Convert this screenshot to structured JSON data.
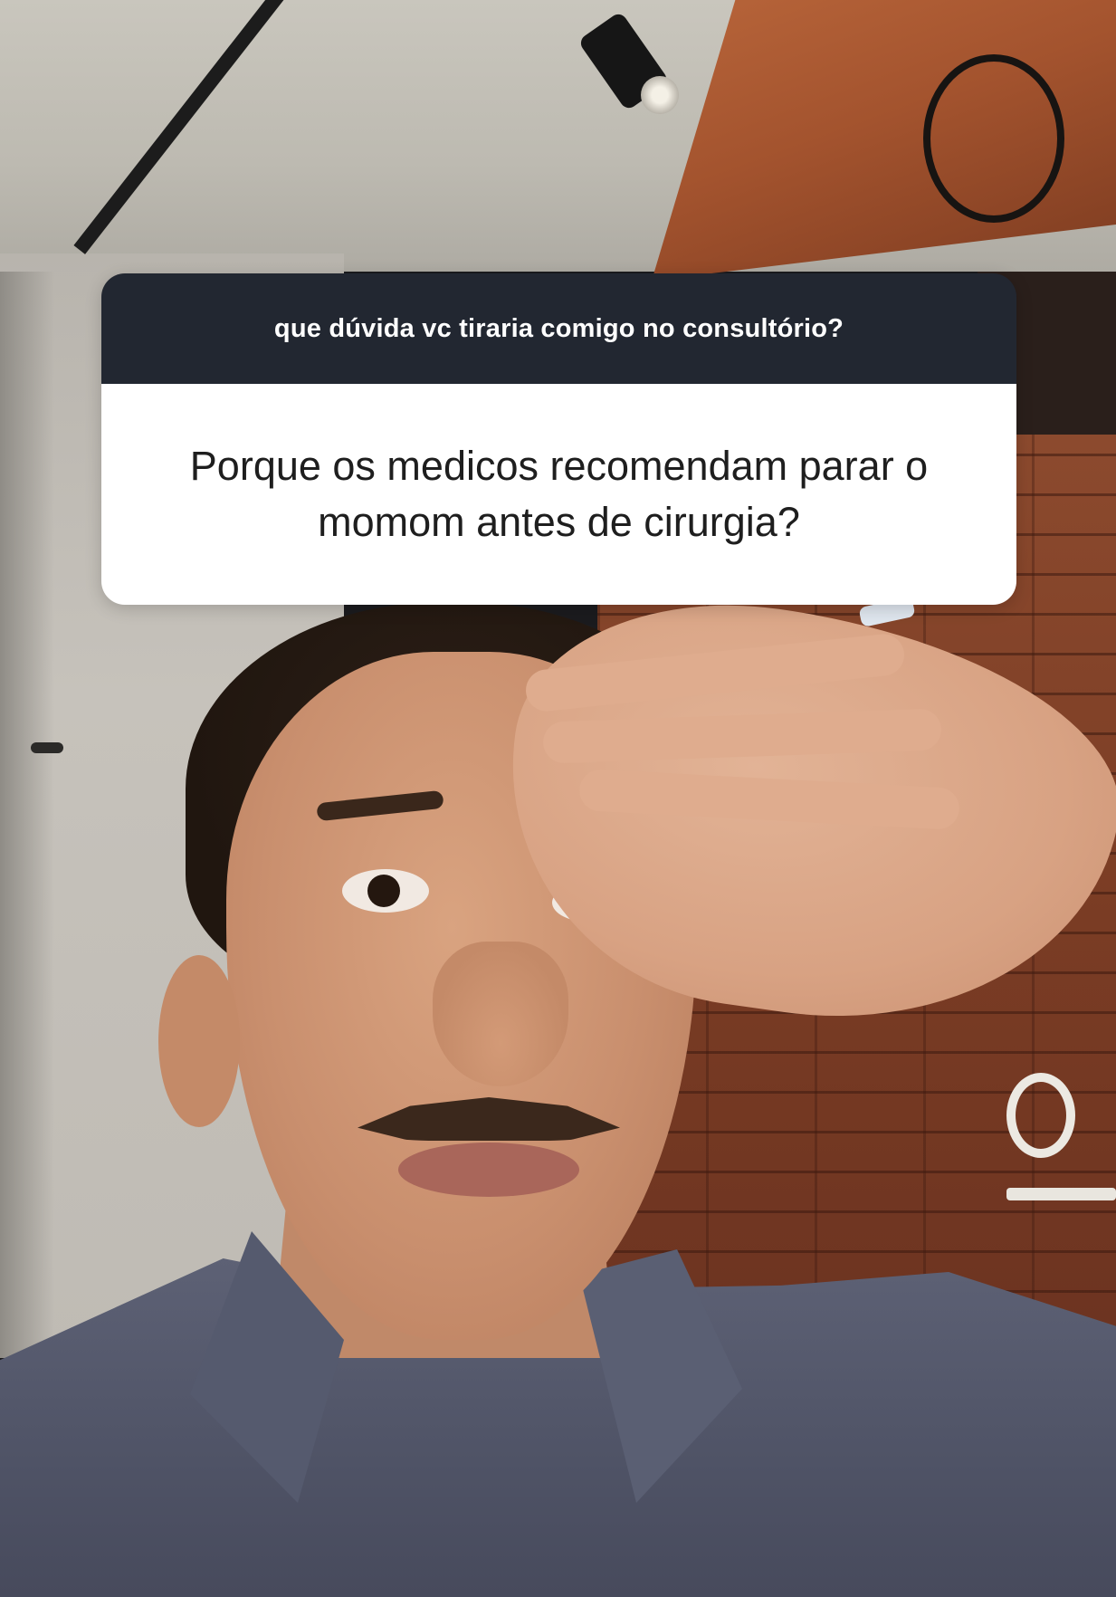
{
  "question_sticker": {
    "prompt": "que dúvida vc tiraria comigo no consultório?",
    "answer": "Porque os medicos recomendam parar o momom antes de cirurgia?",
    "colors": {
      "header_background": "#222731",
      "header_text": "#ffffff",
      "body_background": "#ffffff",
      "body_text": "#1e1e1e"
    }
  }
}
